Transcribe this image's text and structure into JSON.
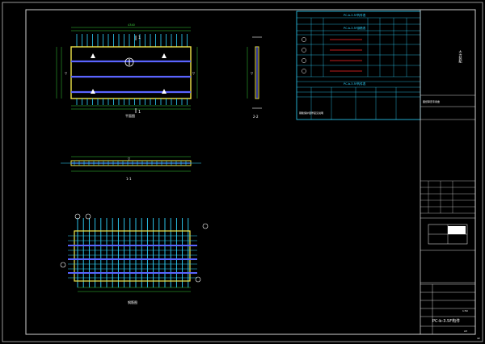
{
  "drawing": {
    "plan_label": "平面图",
    "section_label_1": "1-1",
    "section_label_2": "2-2",
    "rebar_label": "钢筋图",
    "section_mark": "1",
    "dim_total": "4340",
    "dim_mid": "2420",
    "table_title_1": "PC-b-3.5F构件表",
    "table_title_2": "PC-b-3.5F钢筋表",
    "table_title_3": "PC-b-3.5F构件表",
    "remark": "钢筋保护层厚度见说明",
    "tb_company": "大力装配",
    "tb_note": "图纸审查专用章",
    "tb_name": "PC-b-3.5F构件",
    "tb_scale": "1:50",
    "tb_sheet": "A3",
    "tb_fields": [
      "工程名称",
      "设计",
      "校对",
      "审核",
      "审定",
      "批准",
      "专业",
      "阶段",
      "日期",
      "图号"
    ],
    "tb_page": "42"
  },
  "colors": {
    "frame": "#c8c8c8",
    "cyan": "#2fd5ff",
    "yellow": "#f2e84a",
    "blue": "#5a64ff",
    "red": "#ff2828",
    "green": "#3bd13b",
    "white": "#ffffff"
  }
}
